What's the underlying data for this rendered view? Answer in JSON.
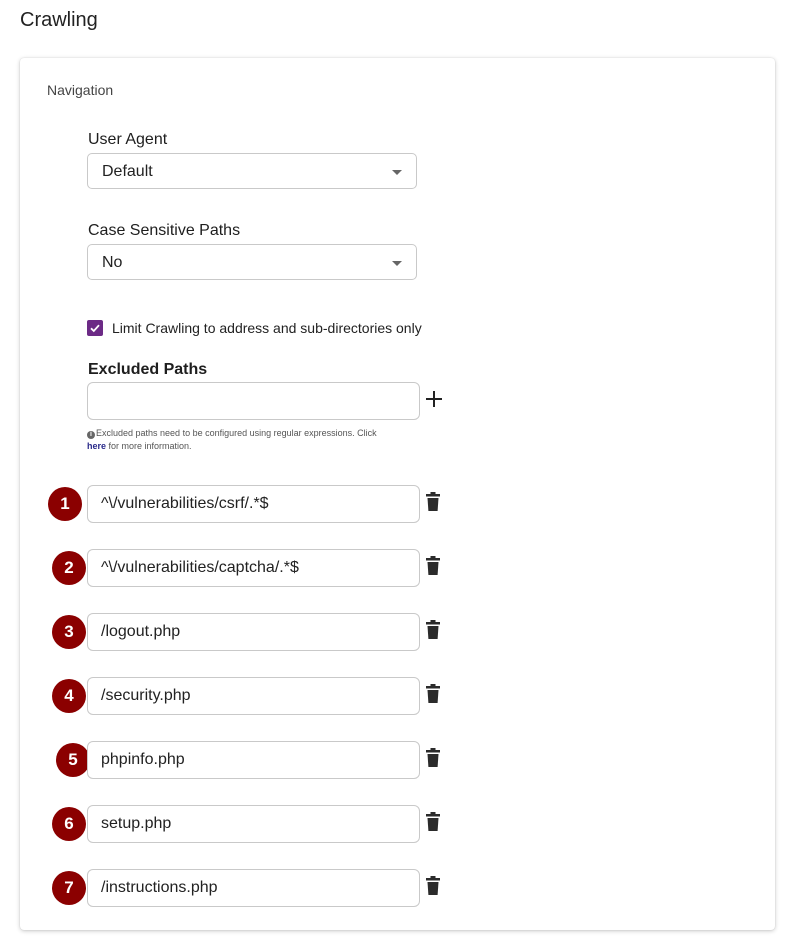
{
  "page": {
    "title": "Crawling"
  },
  "navigation": {
    "section_title": "Navigation",
    "user_agent": {
      "label": "User Agent",
      "value": "Default"
    },
    "case_sensitive": {
      "label": "Case Sensitive Paths",
      "value": "No"
    },
    "limit_crawling": {
      "label": "Limit Crawling to address and sub-directories only",
      "checked": true
    },
    "excluded_paths": {
      "label": "Excluded Paths",
      "input_value": "",
      "help_prefix": "Excluded paths need to be configured using regular expressions. Click ",
      "help_link": "here",
      "help_suffix": " for more information.",
      "items": [
        {
          "badge": "1",
          "value": "^\\/vulnerabilities/csrf/.*$"
        },
        {
          "badge": "2",
          "value": "^\\/vulnerabilities/captcha/.*$"
        },
        {
          "badge": "3",
          "value": "/logout.php"
        },
        {
          "badge": "4",
          "value": "/security.php"
        },
        {
          "badge": "5",
          "value": "phpinfo.php"
        },
        {
          "badge": "6",
          "value": "setup.php"
        },
        {
          "badge": "7",
          "value": "/instructions.php"
        }
      ]
    }
  },
  "colors": {
    "accent": "#6c2a86",
    "badge": "#8b0000"
  },
  "icons": [
    "chevron-down-icon",
    "check-icon",
    "plus-icon",
    "info-icon",
    "trash-icon"
  ]
}
